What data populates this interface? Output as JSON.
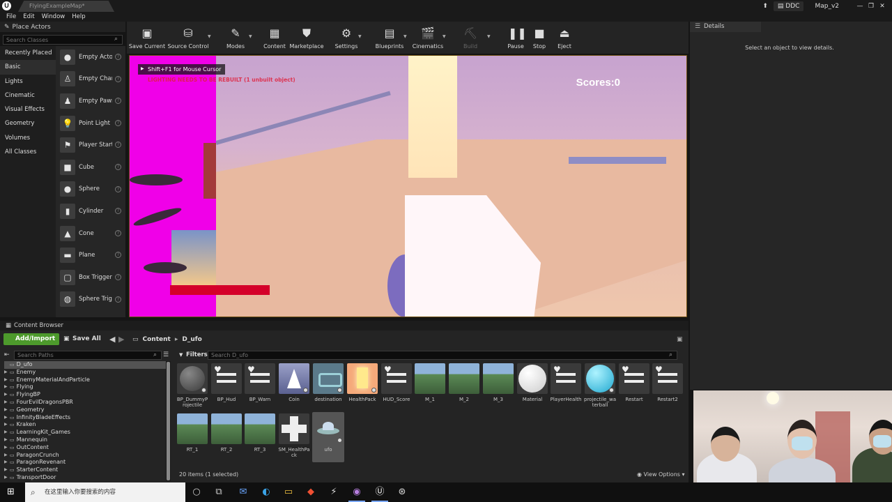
{
  "window": {
    "logo": "U",
    "doc_tab": "FlyingExampleMap*",
    "ddc_label": "DDC",
    "project_name": "Map_v2",
    "controls": [
      "—",
      "❐",
      "✕"
    ]
  },
  "menubar": [
    "File",
    "Edit",
    "Window",
    "Help"
  ],
  "place_actors": {
    "title": "Place Actors",
    "search_placeholder": "Search Classes",
    "categories": [
      "Recently Placed",
      "Basic",
      "Lights",
      "Cinematic",
      "Visual Effects",
      "Geometry",
      "Volumes",
      "All Classes"
    ],
    "active_category": "Basic",
    "actors": [
      {
        "label": "Empty Actor",
        "icon": "sphere-icon"
      },
      {
        "label": "Empty Character",
        "icon": "character-icon"
      },
      {
        "label": "Empty Pawn",
        "icon": "pawn-icon"
      },
      {
        "label": "Point Light",
        "icon": "bulb-icon"
      },
      {
        "label": "Player Start",
        "icon": "player-start-icon"
      },
      {
        "label": "Cube",
        "icon": "cube-icon"
      },
      {
        "label": "Sphere",
        "icon": "sphere-icon"
      },
      {
        "label": "Cylinder",
        "icon": "cylinder-icon"
      },
      {
        "label": "Cone",
        "icon": "cone-icon"
      },
      {
        "label": "Plane",
        "icon": "plane-icon"
      },
      {
        "label": "Box Trigger",
        "icon": "box-trigger-icon"
      },
      {
        "label": "Sphere Trigger",
        "icon": "sphere-trigger-icon"
      }
    ]
  },
  "toolbar": {
    "buttons": [
      {
        "label": "Save Current",
        "icon": "save-icon",
        "glyph": "▣"
      },
      {
        "label": "Source Control",
        "icon": "source-control-icon",
        "glyph": "⛁"
      },
      {
        "label": "Modes",
        "icon": "modes-icon",
        "glyph": "✎"
      },
      {
        "label": "Content",
        "icon": "content-icon",
        "glyph": "▦"
      },
      {
        "label": "Marketplace",
        "icon": "marketplace-icon",
        "glyph": "⛊"
      },
      {
        "label": "Settings",
        "icon": "settings-icon",
        "glyph": "⚙"
      },
      {
        "label": "Blueprints",
        "icon": "blueprints-icon",
        "glyph": "▤"
      },
      {
        "label": "Cinematics",
        "icon": "cinematics-icon",
        "glyph": "🎬"
      },
      {
        "label": "Build",
        "icon": "build-icon",
        "glyph": "⛏",
        "disabled": true
      },
      {
        "label": "Pause",
        "icon": "pause-icon",
        "glyph": "❚❚"
      },
      {
        "label": "Stop",
        "icon": "stop-icon",
        "glyph": "■"
      },
      {
        "label": "Eject",
        "icon": "eject-icon",
        "glyph": "⏏"
      }
    ]
  },
  "viewport": {
    "hint": "Shift+F1 for Mouse Cursor",
    "warning": "LIGHTING NEEDS TO BE REBUILT (1 unbuilt object)",
    "scores": "Scores:0"
  },
  "details": {
    "title": "Details",
    "empty_text": "Select an object to view details."
  },
  "content_browser": {
    "title": "Content Browser",
    "add_import": "Add/Import",
    "save_all": "Save All",
    "breadcrumb": [
      "Content",
      "D_ufo"
    ],
    "search_paths_placeholder": "Search Paths",
    "filters_label": "Filters",
    "search_placeholder": "Search D_ufo",
    "folders": [
      "D_ufo",
      "Enemy",
      "EnemyMaterialAndParticle",
      "Flying",
      "FlyingBP",
      "FourEvilDragonsPBR",
      "Geometry",
      "InfinityBladeEffects",
      "Kraken",
      "LearningKit_Games",
      "Mannequin",
      "OutContent",
      "ParagonCrunch",
      "ParagonRevenant",
      "StarterContent",
      "TransportDoor"
    ],
    "selected_folder": "D_ufo",
    "assets": [
      {
        "name": "BP_DummyProjectile",
        "thumb": "sphere-grey"
      },
      {
        "name": "BP_Hud",
        "thumb": "blueprint"
      },
      {
        "name": "BP_Warn",
        "thumb": "blueprint"
      },
      {
        "name": "Coin",
        "thumb": "cone"
      },
      {
        "name": "destination",
        "thumb": "dest"
      },
      {
        "name": "HealthPack",
        "thumb": "health"
      },
      {
        "name": "HUD_Score",
        "thumb": "blueprint"
      },
      {
        "name": "M_1",
        "thumb": "landscape"
      },
      {
        "name": "M_2",
        "thumb": "landscape"
      },
      {
        "name": "M_3",
        "thumb": "landscape"
      },
      {
        "name": "Material",
        "thumb": "white-sphere"
      },
      {
        "name": "PlayerHealth",
        "thumb": "blueprint"
      },
      {
        "name": "projectile_waterball",
        "thumb": "cyan-sphere"
      },
      {
        "name": "Restart",
        "thumb": "blueprint"
      },
      {
        "name": "Restart2",
        "thumb": "blueprint"
      },
      {
        "name": "RT_1",
        "thumb": "landscape"
      },
      {
        "name": "RT_2",
        "thumb": "landscape"
      },
      {
        "name": "RT_3",
        "thumb": "landscape"
      },
      {
        "name": "SM_HealthPack",
        "thumb": "cross"
      },
      {
        "name": "ufo",
        "thumb": "ufo",
        "selected": true
      }
    ],
    "item_count": "20 items (1 selected)",
    "view_options": "View Options"
  },
  "taskbar": {
    "search_placeholder": "在这里输入你要搜索的内容",
    "apps": [
      "cortana-icon",
      "task-view-icon",
      "mail-icon",
      "edge-icon",
      "file-explorer-icon",
      "git-icon",
      "visual-studio-icon",
      "github-icon",
      "unreal-icon",
      "unity-icon"
    ]
  }
}
